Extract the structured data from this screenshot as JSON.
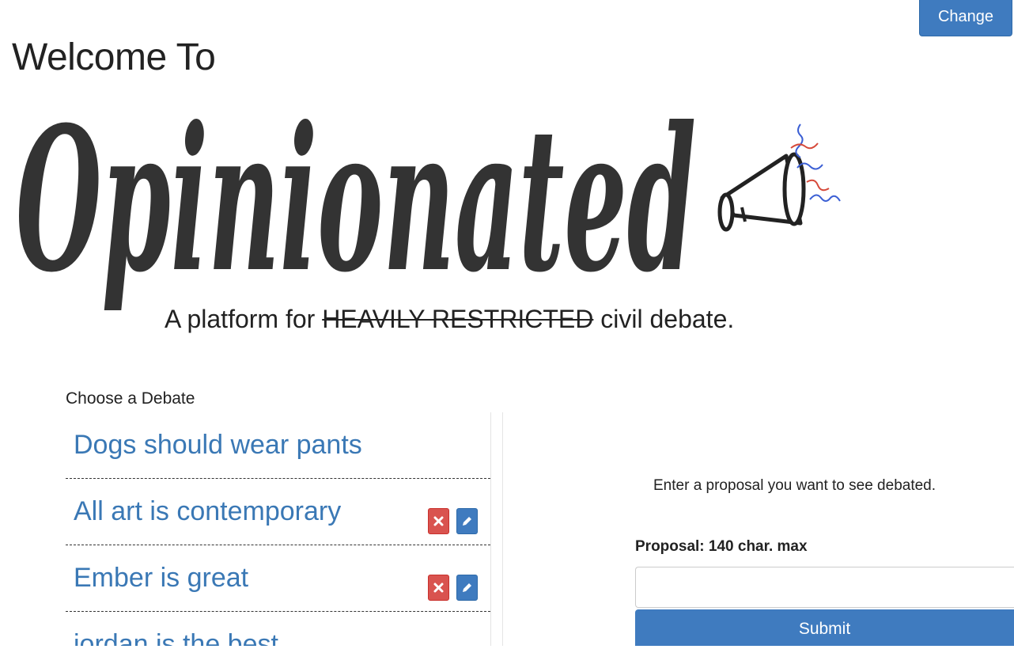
{
  "header": {
    "change_pw_label": "Change PW",
    "welcome_text": "Welcome To"
  },
  "logo": {
    "wordmark": "Opinionated",
    "tagline_prefix": "A platform for ",
    "tagline_struck": "HEAVILY RESTRICTED",
    "tagline_suffix": " civil debate.",
    "icon": "megaphone-icon"
  },
  "debates": {
    "label": "Choose a Debate",
    "items": [
      {
        "title": "Dogs should wear pants",
        "editable": false
      },
      {
        "title": "All art is contemporary",
        "editable": true
      },
      {
        "title": "Ember is great",
        "editable": true
      },
      {
        "title": "jordan is the best",
        "editable": false
      }
    ]
  },
  "proposal_form": {
    "prompt": "Enter a proposal you want to see debated.",
    "field_label": "Proposal: 140 char. max",
    "input_value": "",
    "submit_label": "Submit"
  },
  "colors": {
    "primary": "#3f7bbf",
    "danger": "#d9534f",
    "link": "#3a78b5",
    "logo_ink": "#333333"
  }
}
